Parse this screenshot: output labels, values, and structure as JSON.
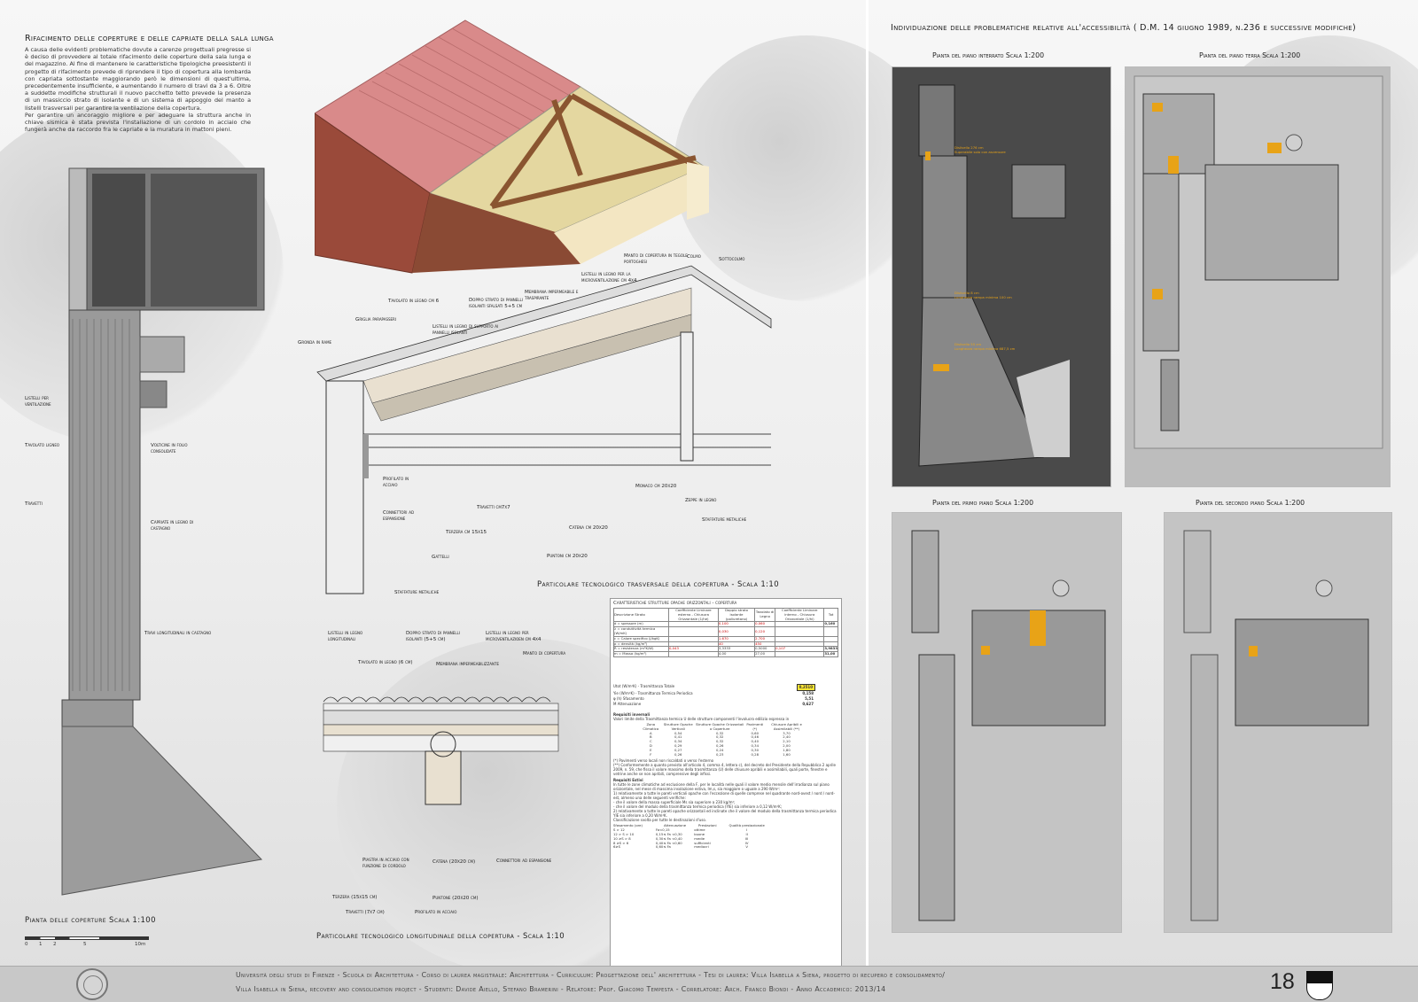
{
  "left_panel": {
    "title": "Rifacimento delle coperture e delle capriate della sala lunga",
    "intro_paragraphs": [
      "A causa delle evidenti problematiche dovute a carenze progettuali pregresse si è deciso di provvedere al totale rifacimento delle coperture della sala lunga e del magazzino. Al fine di mantenere le caratteristiche tipologiche preesistenti il progetto di rifacimento prevede di riprendere il tipo di copertura alla lombarda con capriata sottostante maggiorando però le dimensioni di quest'ultima, precedentemente insufficiente, e aumentando il numero di travi da 3 a 6. Oltre a suddette modifiche strutturali il nuovo pacchetto tetto prevede la presenza di un massiccio strato di isolante e di un sistema di appoggio del manto a listelli trasversali per garantire la ventilazione della copertura.",
      "Per garantire un ancoraggio migliore e per adeguare la struttura anche in chiave sismica è stata prevista l'installazione di un cordolo in acciaio che fungerà anche da raccordo fra le capriate e la muratura in mattoni pieni."
    ],
    "roof_plan": {
      "caption": "Pianta delle coperture   Scala 1:100",
      "labels": {
        "listelli": "Listelli per ventilazione",
        "tavolato": "Tavolato ligneo",
        "travetti": "Travetti",
        "volticine": "Volticine in folio consolidate",
        "capriate": "Capriate in legno di castagno",
        "travi": "Travi longitudinali in castagno"
      },
      "scale_ticks": [
        "0",
        "1",
        "2",
        "5",
        "10m"
      ]
    }
  },
  "middle_panel": {
    "transverse_detail": {
      "caption": "Particolare tecnologico trasversale della copertura  -  Scala 1:10",
      "labels": {
        "manto": "Manto di copertura in tegole portoghesi",
        "colmo": "Colmo",
        "sottocolmo": "Sottocolmo",
        "listelli_micro": "Listelli in legno per la microventilazione cm 4x4",
        "membrana": "Membrana impermeabile e traspirante",
        "doppio_strato": "Doppio strato di pannelli isolanti sfalsati 5+5 cm",
        "tavolato": "Tavolato in legno cm 6",
        "listelli_supporto": "Listelli in legno di supporto ai pannelli isolanti",
        "griglia": "Griglia parapasseri",
        "gronda": "Gronda in rame",
        "profilato": "Profilato in acciaio",
        "connettori": "Connettori ad espansione",
        "gattelli": "Gattelli",
        "staffature1": "Staffature metaliche",
        "terzera": "Terzera cm 15x15",
        "travetti": "Travetti cm7x7",
        "monaco": "Monaco cm 20x20",
        "zeppe": "Zeppe in legno",
        "staffature2": "Staffature metaliche",
        "catena": "Catena cm 20x20",
        "puntoni": "Puntoni cm 20x20"
      }
    },
    "longitudinal_detail": {
      "caption": "Particolare tecnologico longitudinale della copertura  -  Scala 1:10",
      "labels": {
        "listelli_long": "Listelli in legno longitudinali",
        "doppio_strato": "Doppio strato di pannelli isolanti (5+5 cm)",
        "listelli_micro": "Listelli in legno per microventilazioen cm 4x4",
        "manto": "Manto di copertura",
        "tavolato": "Tavolato in legno (6 cm)",
        "membrana": "Membrana impermeabilizzante",
        "piastra": "Piastra in acciaio con funzione di cordolo",
        "catena": "Catena (20x20 cm)",
        "connettori": "Connettori ad espansione",
        "terzera": "Terzera (15x15 cm)",
        "puntone": "Puntone (20x20 cm)",
        "travetti": "Travetti (7x7 cm)",
        "profilato": "Profilato in acciaio"
      }
    },
    "table": {
      "title": "Caratteristiche strutture opache orizzontali - copertura",
      "headers": [
        "Descrizione Strato",
        "Coefficiente Liminare esterno - Chiusura Orizzontale (1/he)",
        "Doppio strato isolante (poliuretano)",
        "Tavolato di Legno",
        "Coefficiente Liminare interno - Chiusura Orizzontale (1/hi)",
        "Tot"
      ],
      "rows": [
        [
          "d = spessore (m)",
          "",
          "0,100",
          "0,060",
          "",
          "0,160"
        ],
        [
          "λ = conduttività termica (W/mK)",
          "",
          "0,030",
          "0,120",
          "",
          ""
        ],
        [
          "c = Calore specifico (J/kgK)",
          "",
          "1.670",
          "2.700",
          "",
          ""
        ],
        [
          "ρ = densità (kg/m³)",
          "",
          "40",
          "450",
          "",
          ""
        ],
        [
          "R = resistenza (m²K/W)",
          "0,043",
          "3,3333",
          "0,5000",
          "0,107",
          "3,9833"
        ],
        [
          "m = Massa (kg/m²)",
          "",
          "4,00",
          "27,00",
          "",
          "31,00"
        ]
      ],
      "results": [
        {
          "label": "Utot (W/m²K) - Trasmittanza Totale",
          "value": "0,2510"
        },
        {
          "label": "Yie (W/m²K) - Trasmittanza Termica Periodica",
          "value": "0,158"
        },
        {
          "label": "φ (h) Sfasamento",
          "value": "5,51"
        },
        {
          "label": "M Attenuazione",
          "value": "0,627"
        }
      ],
      "requisiti_title": "Requisiti invernali",
      "requisiti_text": "Valori limite della Trasmittanza termica U delle strutture componenti l'involucro edilizio espressa in",
      "zone_headers": [
        "Zona Climatica",
        "Strutture Opache Verticali",
        "Strutture Opache Orizzontali o Coperture",
        "Pavimenti (*)",
        "Chiusure Apribili e Assimilabili (**)"
      ],
      "zone_rows": [
        [
          "A",
          "0,54",
          "0,32",
          "0,60",
          "3,70"
        ],
        [
          "B",
          "0,41",
          "0,32",
          "0,46",
          "2,40"
        ],
        [
          "C",
          "0,34",
          "0,32",
          "0,40",
          "2,10"
        ],
        [
          "D",
          "0,29",
          "0,26",
          "0,34",
          "2,00"
        ],
        [
          "E",
          "0,27",
          "0,24",
          "0,30",
          "1,80"
        ],
        [
          "F",
          "0,26",
          "0,23",
          "0,28",
          "1,60"
        ]
      ],
      "note1": "(*) Pavimenti verso locali non riscaldati o verso l'esterno",
      "note2": "(**) Conformemente a quanto previsto all'articolo 4, comma 4, lettera c), del decreto del Presidente della Repubblica 2 aprile 2009, n. 59, che fissa il valore massimo della trasmittanza (U) delle chiusure apribili e assimilabili, quali porte, finestre e vetrine anche se non apribili, comprensive degli infissi.",
      "estivi_title": "Requisiti Estivi",
      "estivi_text": "In tutte le zone climatiche ad esclusione della F, per le località nelle quali il valore medio mensile dell'irradianza sul piano orizzontale, nel mese di massima insolazione estiva, Im,s, sia maggiore o uguale a 290 W/m²:",
      "estivi_items": [
        "1) relativamente a tutte le pareti verticali opache con l'eccezione di quelle comprese nel quadrante nord-ovest / nord / nord-est, almeno una delle seguenti verifiche:",
        "- che il valore della massa superficiale Ms sia superiore a 230 kg/m²;",
        "- che il valore del modulo della trasmittanza termica periodica (YIE) sia inferiore a 0,12 W/m²K;",
        "2) relativamente a tutte le pareti opache orizzontali ed inclinate che il valore del modulo della trasmittanza termica periodica YIE sia inferiore a 0,20 W/m²K.",
        "Classificazione svolta per tutte le destinazioni d'uso."
      ],
      "sfas_headers": [
        "Sfasamento (ore)",
        "Attenuazione",
        "Prestazioni",
        "Qualità prestazionale"
      ],
      "sfas_rows": [
        [
          "S > 12",
          "Fa<0,15",
          "ottime",
          "I"
        ],
        [
          "12 > S > 10",
          "0,15≤ Fa <0,30",
          "buone",
          "II"
        ],
        [
          "10 ≥S > 8",
          "0,30≤ Fa <0,40",
          "medie",
          "III"
        ],
        [
          "8 ≥S > 6",
          "0,40≤ Fa <0,60",
          "sufficienti",
          "IV"
        ],
        [
          "6≥S",
          "0,60≤ Fa",
          "mediocri",
          "V"
        ]
      ]
    }
  },
  "right_panel": {
    "title": "Individuazione delle problematiche relative all'accessibilità ( D.M. 14 giugno 1989, n.236 e successive modifiche)",
    "plans": [
      {
        "title": "Pianta del piano interrato  Scala 1:200"
      },
      {
        "title": "Pianta del piano terra  Scala 1:200"
      },
      {
        "title": "Pianta del primo piano  Scala 1:200"
      },
      {
        "title": "Pianta del secondo piano  Scala 1:200"
      }
    ],
    "notes": [
      "Dislivello 276 cm",
      "Superabile solo con ascensore",
      "Dislivello 8 cm",
      "Lunghezza rampa minima 100 cm",
      "Dislivello 55 cm",
      "Lunghezza rampa minima 687,5 cm"
    ]
  },
  "footer": {
    "line1": "Università degli studi di Firenze - Scuola di Architettura - Corso di laurea magistrale: Architettura - Curriculum: Progettazione dell' architettura - Tesi di laurea: Villa Isabella a Siena, progetto di recupero e consolidamento/",
    "line2": "Villa Isabella in Siena, recovery and consolidation project - Studenti: Davide Aiello, Stefano Bramerini - Relatore: Prof. Giacomo Tempesta - Correlatore: Arch. Franco Biondi - Anno Accademico: 2013/14",
    "page_number": "18"
  },
  "colors": {
    "accent_yellow": "#e8a317",
    "roof_tile": "#d98a8a",
    "timber": "#a0663a",
    "brick": "#9a4a3a"
  }
}
